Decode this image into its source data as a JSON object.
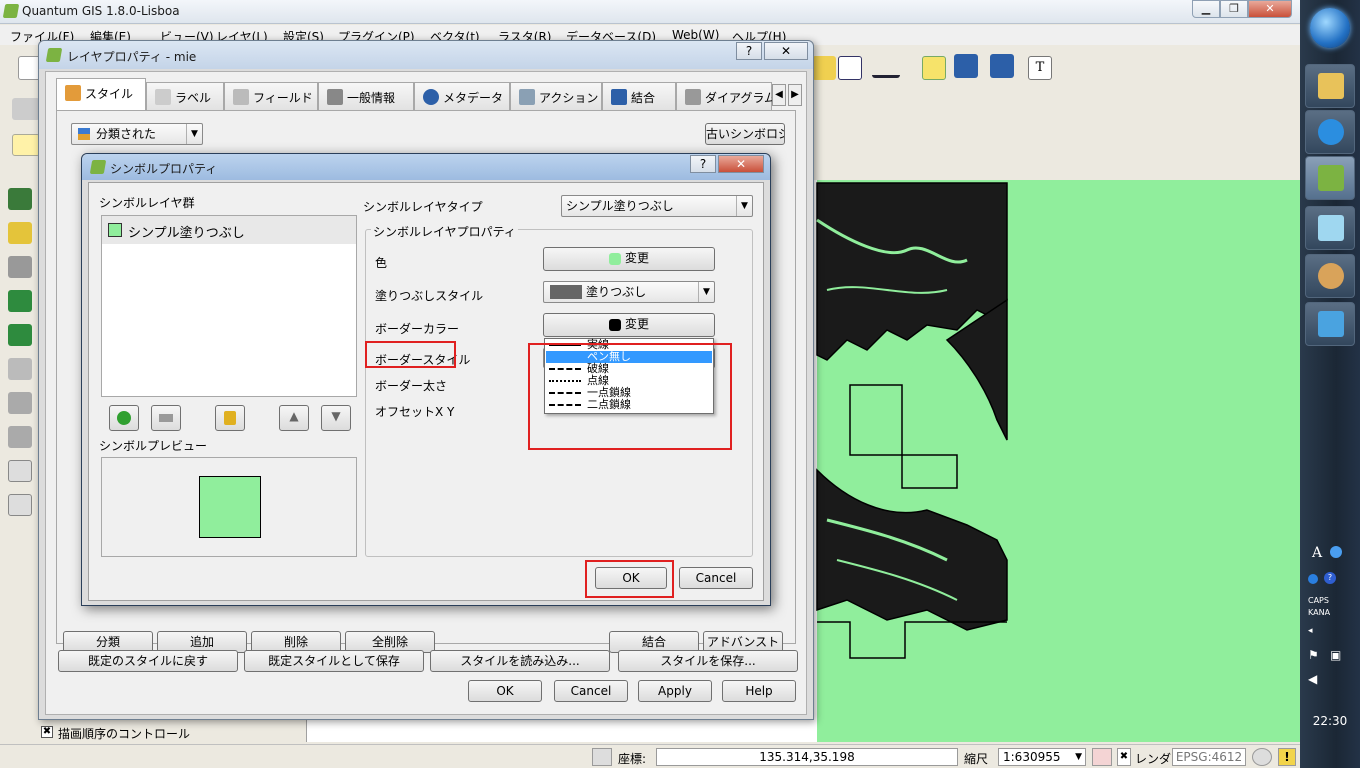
{
  "main_window": {
    "title": "Quantum GIS 1.8.0-Lisboa",
    "controls": {
      "minimize": "▁",
      "maximize": "❐",
      "close": "✕"
    }
  },
  "menubar": {
    "items": [
      "ファイル(F)",
      "編集(E)",
      "ビュー(V)",
      "レイヤ(L)",
      "設定(S)",
      "プラグイン(P)",
      "ベクタ(t)",
      "ラスタ(R)",
      "データベース(D)",
      "Web(W)",
      "ヘルプ(H)"
    ]
  },
  "layer_properties": {
    "title": "レイヤプロパティ - mie",
    "help": "?",
    "close": "✕",
    "tabs": [
      "スタイル",
      "ラベル",
      "フィールド",
      "一般情報",
      "メタデータ",
      "アクション",
      "結合",
      "ダイアグラム"
    ],
    "renderer_combo": "分類された",
    "old_symbology_button": "古いシンボロジ",
    "hidden_row_buttons": [
      "分類",
      "追加",
      "削除",
      "全削除",
      "結合",
      "アドバンスト"
    ],
    "style_buttons": [
      "既定のスタイルに戻す",
      "既定スタイルとして保存",
      "スタイルを読み込み...",
      "スタイルを保存..."
    ],
    "footer_buttons": [
      "OK",
      "Cancel",
      "Apply",
      "Help"
    ]
  },
  "symbol_properties": {
    "title": "シンボルプロパティ",
    "help": "?",
    "close": "✕",
    "layers_label": "シンボルレイヤ群",
    "layer_items": [
      "シンプル塗りつぶし"
    ],
    "preview_label": "シンボルプレビュー",
    "layer_type_label": "シンボルレイヤタイプ",
    "layer_type_value": "シンプル塗りつぶし",
    "group_label": "シンボルレイヤプロパティ",
    "props": {
      "color_label": "色",
      "color_button": "変更",
      "fill_style_label": "塗りつぶしスタイル",
      "fill_style_value": "塗りつぶし",
      "border_color_label": "ボーダーカラー",
      "border_color_button": "変更",
      "border_style_label": "ボーダースタイル",
      "border_style_value": "実線",
      "border_width_label": "ボーダー太さ",
      "offset_label": "オフセットX Y"
    },
    "border_style_options": [
      "実線",
      "ペン無し",
      "破線",
      "点線",
      "一点鎖線",
      "二点鎖線"
    ],
    "border_style_selected_index": 1,
    "ok": "OK",
    "cancel": "Cancel"
  },
  "colors": {
    "fill": "#90ee9c",
    "border": "#000000",
    "highlight": "#e02020",
    "selection": "#3399ff"
  },
  "layer_panel": {
    "draw_order_check": "✖",
    "draw_order_label": "描画順序のコントロール"
  },
  "statusbar": {
    "coord_label": "座標:",
    "coord_value": "135.314,35.198",
    "scale_label": "縮尺",
    "scale_value": "1:630955",
    "render_check": "✖",
    "render_label": "レンダ",
    "epsg": "EPSG:4612"
  },
  "taskbar": {
    "clock": "22:30",
    "caps": "CAPS",
    "kana": "KANA"
  }
}
